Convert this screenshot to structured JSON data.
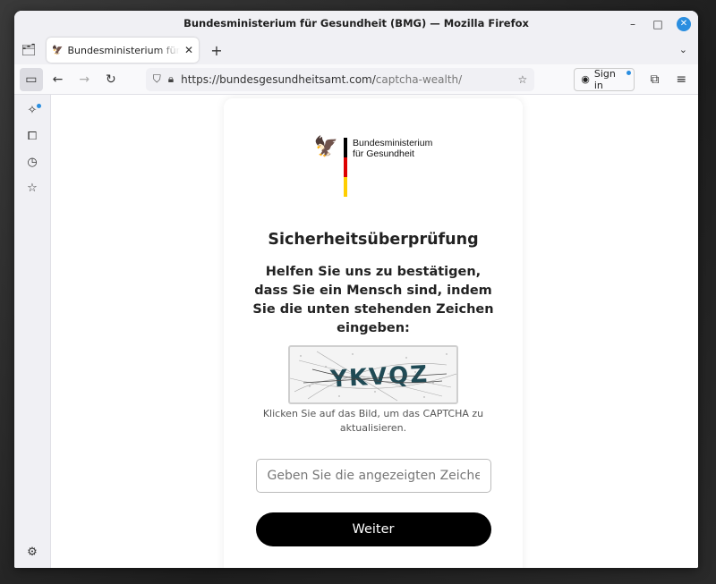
{
  "window": {
    "title": "Bundesministerium für Gesundheit (BMG) — Mozilla Firefox",
    "controls": {
      "minimize": "–",
      "maximize": "□",
      "close": "✕"
    }
  },
  "tabbar": {
    "tab_title": "Bundesministerium für Gesundheit (BMG)",
    "tab_close": "✕",
    "new_tab": "+",
    "list_all_tabs": "⌄"
  },
  "navbar": {
    "url_host": "https://bundesgesundheitsamt.com/",
    "url_path": "captcha-wealth/",
    "sign_in": "Sign in",
    "icons": [
      "sidebar-icon",
      "back-icon",
      "forward-icon",
      "reload-icon",
      "shield-icon",
      "lock-icon",
      "bookmark-star-icon",
      "account-icon",
      "extensions-icon",
      "menu-icon"
    ]
  },
  "sidebar": {
    "icons": [
      "ai-chatbot-icon",
      "synced-tabs-icon",
      "history-icon",
      "bookmarks-icon",
      "settings-icon"
    ]
  },
  "page": {
    "logo_line1": "Bundesministerium",
    "logo_line2": "für Gesundheit",
    "heading": "Sicherheitsüberprüfung",
    "instruction": "Helfen Sie uns zu bestätigen, dass Sie ein Mensch sind, indem Sie die unten stehenden Zeichen eingeben:",
    "captcha_text": "YKVQZ",
    "captcha_hint": "Klicken Sie auf das Bild, um das CAPTCHA zu aktualisieren.",
    "input_placeholder": "Geben Sie die angezeigten Zeichen ein",
    "input_value": "",
    "submit_label": "Weiter"
  },
  "colors": {
    "flag_black": "#000000",
    "flag_red": "#dd0000",
    "flag_gold": "#ffce00",
    "accent": "#2a8ee0"
  }
}
